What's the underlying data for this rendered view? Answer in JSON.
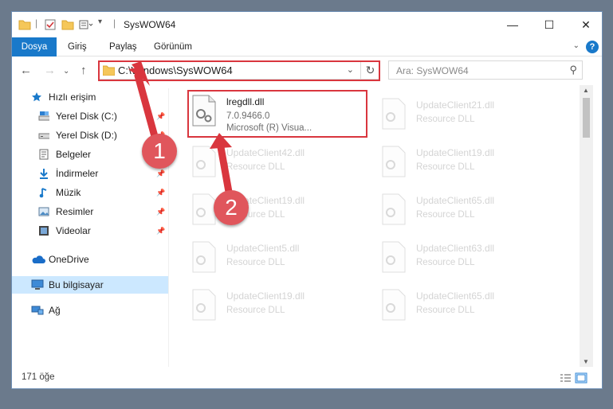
{
  "window": {
    "title": "SysWOW64",
    "controls": {
      "minimize": "—",
      "maximize": "☐",
      "close": "✕"
    }
  },
  "ribbon": {
    "tabs": [
      {
        "label": "Dosya"
      },
      {
        "label": "Giriş"
      },
      {
        "label": "Paylaş"
      },
      {
        "label": "Görünüm"
      }
    ],
    "help": "?"
  },
  "navigation": {
    "address": "C:\\Windows\\SysWOW64",
    "search_placeholder": "Ara: SysWOW64"
  },
  "sidebar": {
    "items": [
      {
        "label": "Hızlı erişim",
        "icon": "star-icon"
      },
      {
        "label": "Yerel Disk (C:)",
        "icon": "drive-icon"
      },
      {
        "label": "Yerel Disk (D:)",
        "icon": "drive-icon"
      },
      {
        "label": "Belgeler",
        "icon": "documents-icon"
      },
      {
        "label": "İndirmeler",
        "icon": "download-icon"
      },
      {
        "label": "Müzik",
        "icon": "music-icon"
      },
      {
        "label": "Resimler",
        "icon": "pictures-icon"
      },
      {
        "label": "Videolar",
        "icon": "videos-icon"
      },
      {
        "label": "OneDrive",
        "icon": "cloud-icon"
      },
      {
        "label": "Bu bilgisayar",
        "icon": "computer-icon"
      },
      {
        "label": "Ağ",
        "icon": "network-icon"
      }
    ]
  },
  "files": {
    "highlighted": {
      "name": "lregdll.dll",
      "version": "7.0.9466.0",
      "company": "Microsoft (R) Visua..."
    },
    "left_column": [
      {
        "name": "UpdateClient42.dll",
        "type": "Resource DLL"
      },
      {
        "name": "UpdateClient19.dll",
        "type": "Resource DLL"
      },
      {
        "name": "UpdateClient5.dll",
        "type": "Resource DLL"
      },
      {
        "name": "UpdateClient19.dll",
        "type": "Resource DLL"
      }
    ],
    "right_column": [
      {
        "name": "UpdateClient21.dll",
        "type": "Resource DLL"
      },
      {
        "name": "UpdateClient19.dll",
        "type": "Resource DLL"
      },
      {
        "name": "UpdateClient65.dll",
        "type": "Resource DLL"
      },
      {
        "name": "UpdateClient63.dll",
        "type": "Resource DLL"
      },
      {
        "name": "UpdateClient65.dll",
        "type": "Resource DLL"
      }
    ]
  },
  "status": {
    "count": "171 öğe"
  },
  "annotations": {
    "step1": "1",
    "step2": "2",
    "color": "#d9363e"
  },
  "colors": {
    "accent": "#1979ca",
    "selection": "#cce8ff",
    "folder": "#f5c75a"
  }
}
